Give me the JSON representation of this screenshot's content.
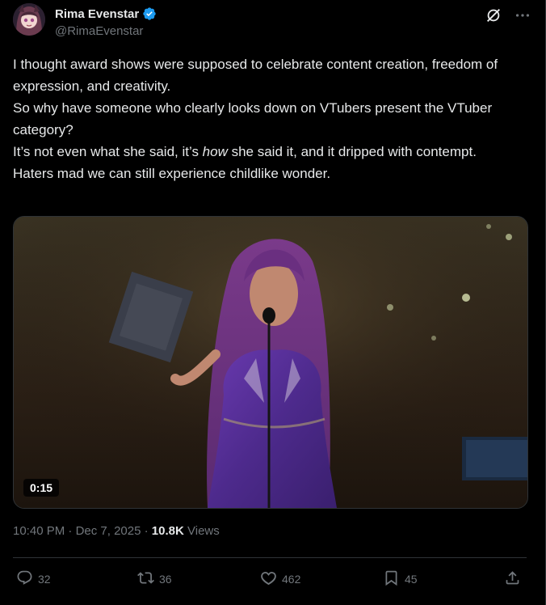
{
  "author": {
    "display_name": "Rima Evenstar",
    "handle": "@RimaEvenstar"
  },
  "tweet": {
    "line1": "I thought award shows were supposed to celebrate content creation, freedom of expression, and creativity.",
    "line2": "So why have someone who clearly looks down on VTubers present the VTuber category?",
    "line3_a": "It’s not even what she said, it’s ",
    "line3_em": "how",
    "line3_b": " she said it, and it dripped with contempt.",
    "line4": "Haters mad we can still experience childlike wonder."
  },
  "media": {
    "duration": "0:15"
  },
  "meta": {
    "time": "10:40 PM",
    "separator": " · ",
    "date": "Dec 7, 2025",
    "views_count": "10.8K",
    "views_label": "Views"
  },
  "actions": {
    "replies": "32",
    "reposts": "36",
    "likes": "462",
    "bookmarks": "45"
  },
  "icons": [
    "verified-badge-icon",
    "grok-icon",
    "more-icon",
    "reply-icon",
    "repost-icon",
    "like-icon",
    "bookmark-icon",
    "share-icon"
  ],
  "colors": {
    "background": "#000000",
    "text": "#e7e9ea",
    "secondary": "#71767b",
    "verified": "#1d9bf0",
    "border": "#2f3336"
  }
}
